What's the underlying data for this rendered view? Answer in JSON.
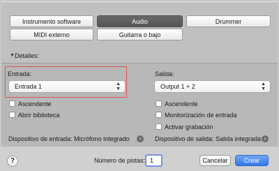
{
  "tabs": {
    "software_instrument": "Instrumento software",
    "audio": "Audio",
    "drummer": "Drummer",
    "external_midi": "MIDI externo",
    "guitar_bass": "Guitarra o bajo"
  },
  "details": {
    "label": "Detalles:"
  },
  "input": {
    "label": "Entrada:",
    "value": "Entrada 1",
    "ascending": "Ascendente",
    "open_library": "Abrir biblioteca",
    "device_info": "Dispositivo de entrada: Micrófono integrado"
  },
  "output": {
    "label": "Salida:",
    "value": "Output 1 + 2",
    "ascending": "Ascendente",
    "input_monitoring": "Monitorización de entrada",
    "record_enable": "Activar grabación",
    "device_info": "Dispositivo de salida: Salida integrada"
  },
  "footer": {
    "help": "?",
    "tracks_label": "Número de pistas:",
    "tracks_value": "1",
    "cancel": "Cancelar",
    "create": "Crear"
  },
  "colors": {
    "accent": "#3477e8",
    "highlight_box": "#d9534f",
    "selected_tab": "#5e5e5e"
  }
}
